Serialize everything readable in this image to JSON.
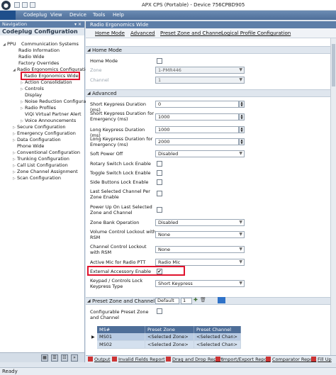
{
  "window": {
    "title": "APX CPS (Portable) - Device 756CPBD905"
  },
  "menu": {
    "items": [
      "Codeplug",
      "View",
      "Device",
      "Tools",
      "Help"
    ]
  },
  "navigation": {
    "header": "Navigation",
    "pin": "▾ ✕",
    "subheader": "Codeplug Configuration",
    "tree": [
      "PPU",
      "Communication Systems",
      "Radio Information",
      "Radio Wide",
      "Factory Overrides",
      "Radio Ergonomics Configuratio",
      "Radio Ergonomics Wide",
      "Action Consolidation",
      "Controls",
      "Display",
      "Noise Reduction Configurat",
      "Radio Profiles",
      "ViQi Virtual Partner Alert",
      "Voice Announcements",
      "Secure Configuration",
      "Emergency Configuration",
      "Data Configuration",
      "Phone Wide",
      "Conventional Configuration",
      "Trunking Configuration",
      "Call List Configuration",
      "Zone Channel Assignment",
      "Scan Configuration"
    ]
  },
  "main": {
    "header": "Radio Ergonomics Wide",
    "tabs": [
      "Home Mode",
      "Advanced",
      "Preset Zone and Channel",
      "Logical Profile Configuration"
    ],
    "home_mode": {
      "title": "Home Mode",
      "home_mode_label": "Home Mode",
      "zone_label": "Zone",
      "zone_value": "1-PMR446",
      "channel_label": "Channel",
      "channel_value": "1"
    },
    "advanced": {
      "title": "Advanced",
      "short_keypress_label": "Short Keypress Duration (ms)",
      "short_keypress_value": "0",
      "short_keypress_emergency_label": "Short Keypress Duration for Emergency (ms)",
      "short_keypress_emergency_value": "1000",
      "long_keypress_label": "Long Keypress Duration (ms)",
      "long_keypress_value": "1000",
      "long_keypress_emergency_label": "Long Keypress Duration for Emergency (ms)",
      "long_keypress_emergency_value": "2000",
      "soft_power_off_label": "Soft Power Off",
      "soft_power_off_value": "Disabled",
      "rotary_lock_label": "Rotary Switch Lock Enable",
      "toggle_lock_label": "Toggle Switch Lock Enable",
      "side_buttons_lock_label": "Side Buttons Lock Enable",
      "last_selected_label": "Last Selected Channel Per Zone Enable",
      "power_up_label": "Power Up On Last Selected Zone and Channel",
      "zone_bank_label": "Zone Bank Operation",
      "zone_bank_value": "Disabled",
      "volume_lockout_label": "Volume Control Lockout with RSM",
      "volume_lockout_value": "None",
      "channel_lockout_label": "Channel Control Lockout with RSM",
      "channel_lockout_value": "None",
      "active_mic_label": "Active Mic for Radio PTT",
      "active_mic_value": "Radio Mic",
      "external_accessory_label": "External Accessory Enable",
      "external_accessory_check": "✔",
      "keypad_lock_label": "Keypad / Controls Lock Keypress Type",
      "keypad_lock_value": "Short Keypress"
    },
    "preset_zone": {
      "title": "Preset Zone and Channel",
      "profile_value": "Default",
      "count_value": "1",
      "configurable_label": "Configurable Preset Zone and Channel",
      "columns": [
        "MS#",
        "Preset Zone",
        "Preset Channel"
      ],
      "rows": [
        [
          "MS01",
          "<Selected Zone>",
          "<Selected Chan>"
        ],
        [
          "MS02",
          "<Selected Zone>",
          "<Selected Chan>"
        ]
      ]
    }
  },
  "report_bar": {
    "items": [
      "Output",
      "Invalid Fields Report",
      "Drag and Drop Report",
      "Import/Export Report",
      "Comparator Report",
      "Fill Up"
    ]
  },
  "status": {
    "text": "Ready"
  },
  "colors": {
    "accent": "#5d7ea8",
    "highlight_border": "#e0132d",
    "file_tab": "#1f4f8b"
  }
}
